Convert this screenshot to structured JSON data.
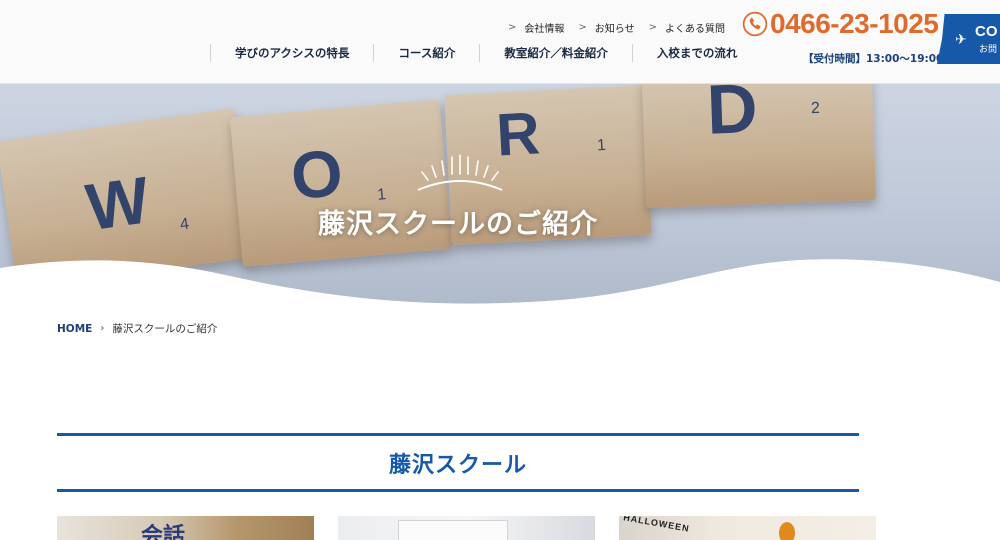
{
  "header": {
    "util_links": [
      "会社情報",
      "お知らせ",
      "よくある質問"
    ],
    "nav_items": [
      "学びのアクシスの特長",
      "コース紹介",
      "教室紹介／料金紹介",
      "入校までの流れ"
    ],
    "phone": "0466-23-1025",
    "hours": "【受付時間】13:00〜19:00",
    "contact_en": "CO",
    "contact_ja": "お問",
    "accent_color": "#e06a2e",
    "brand_color": "#1659a8"
  },
  "hero": {
    "title": "藤沢スクールのご紹介",
    "tiles": [
      {
        "letter": "W",
        "num": "4"
      },
      {
        "letter": "O",
        "num": "1"
      },
      {
        "letter": "R",
        "num": "1"
      },
      {
        "letter": "D",
        "num": "2"
      }
    ]
  },
  "breadcrumb": {
    "home": "HOME",
    "current": "藤沢スクールのご紹介"
  },
  "section": {
    "title": "藤沢スクール"
  },
  "photos": {
    "sign_text": "会話",
    "banner_text": "HALLOWEEN"
  }
}
